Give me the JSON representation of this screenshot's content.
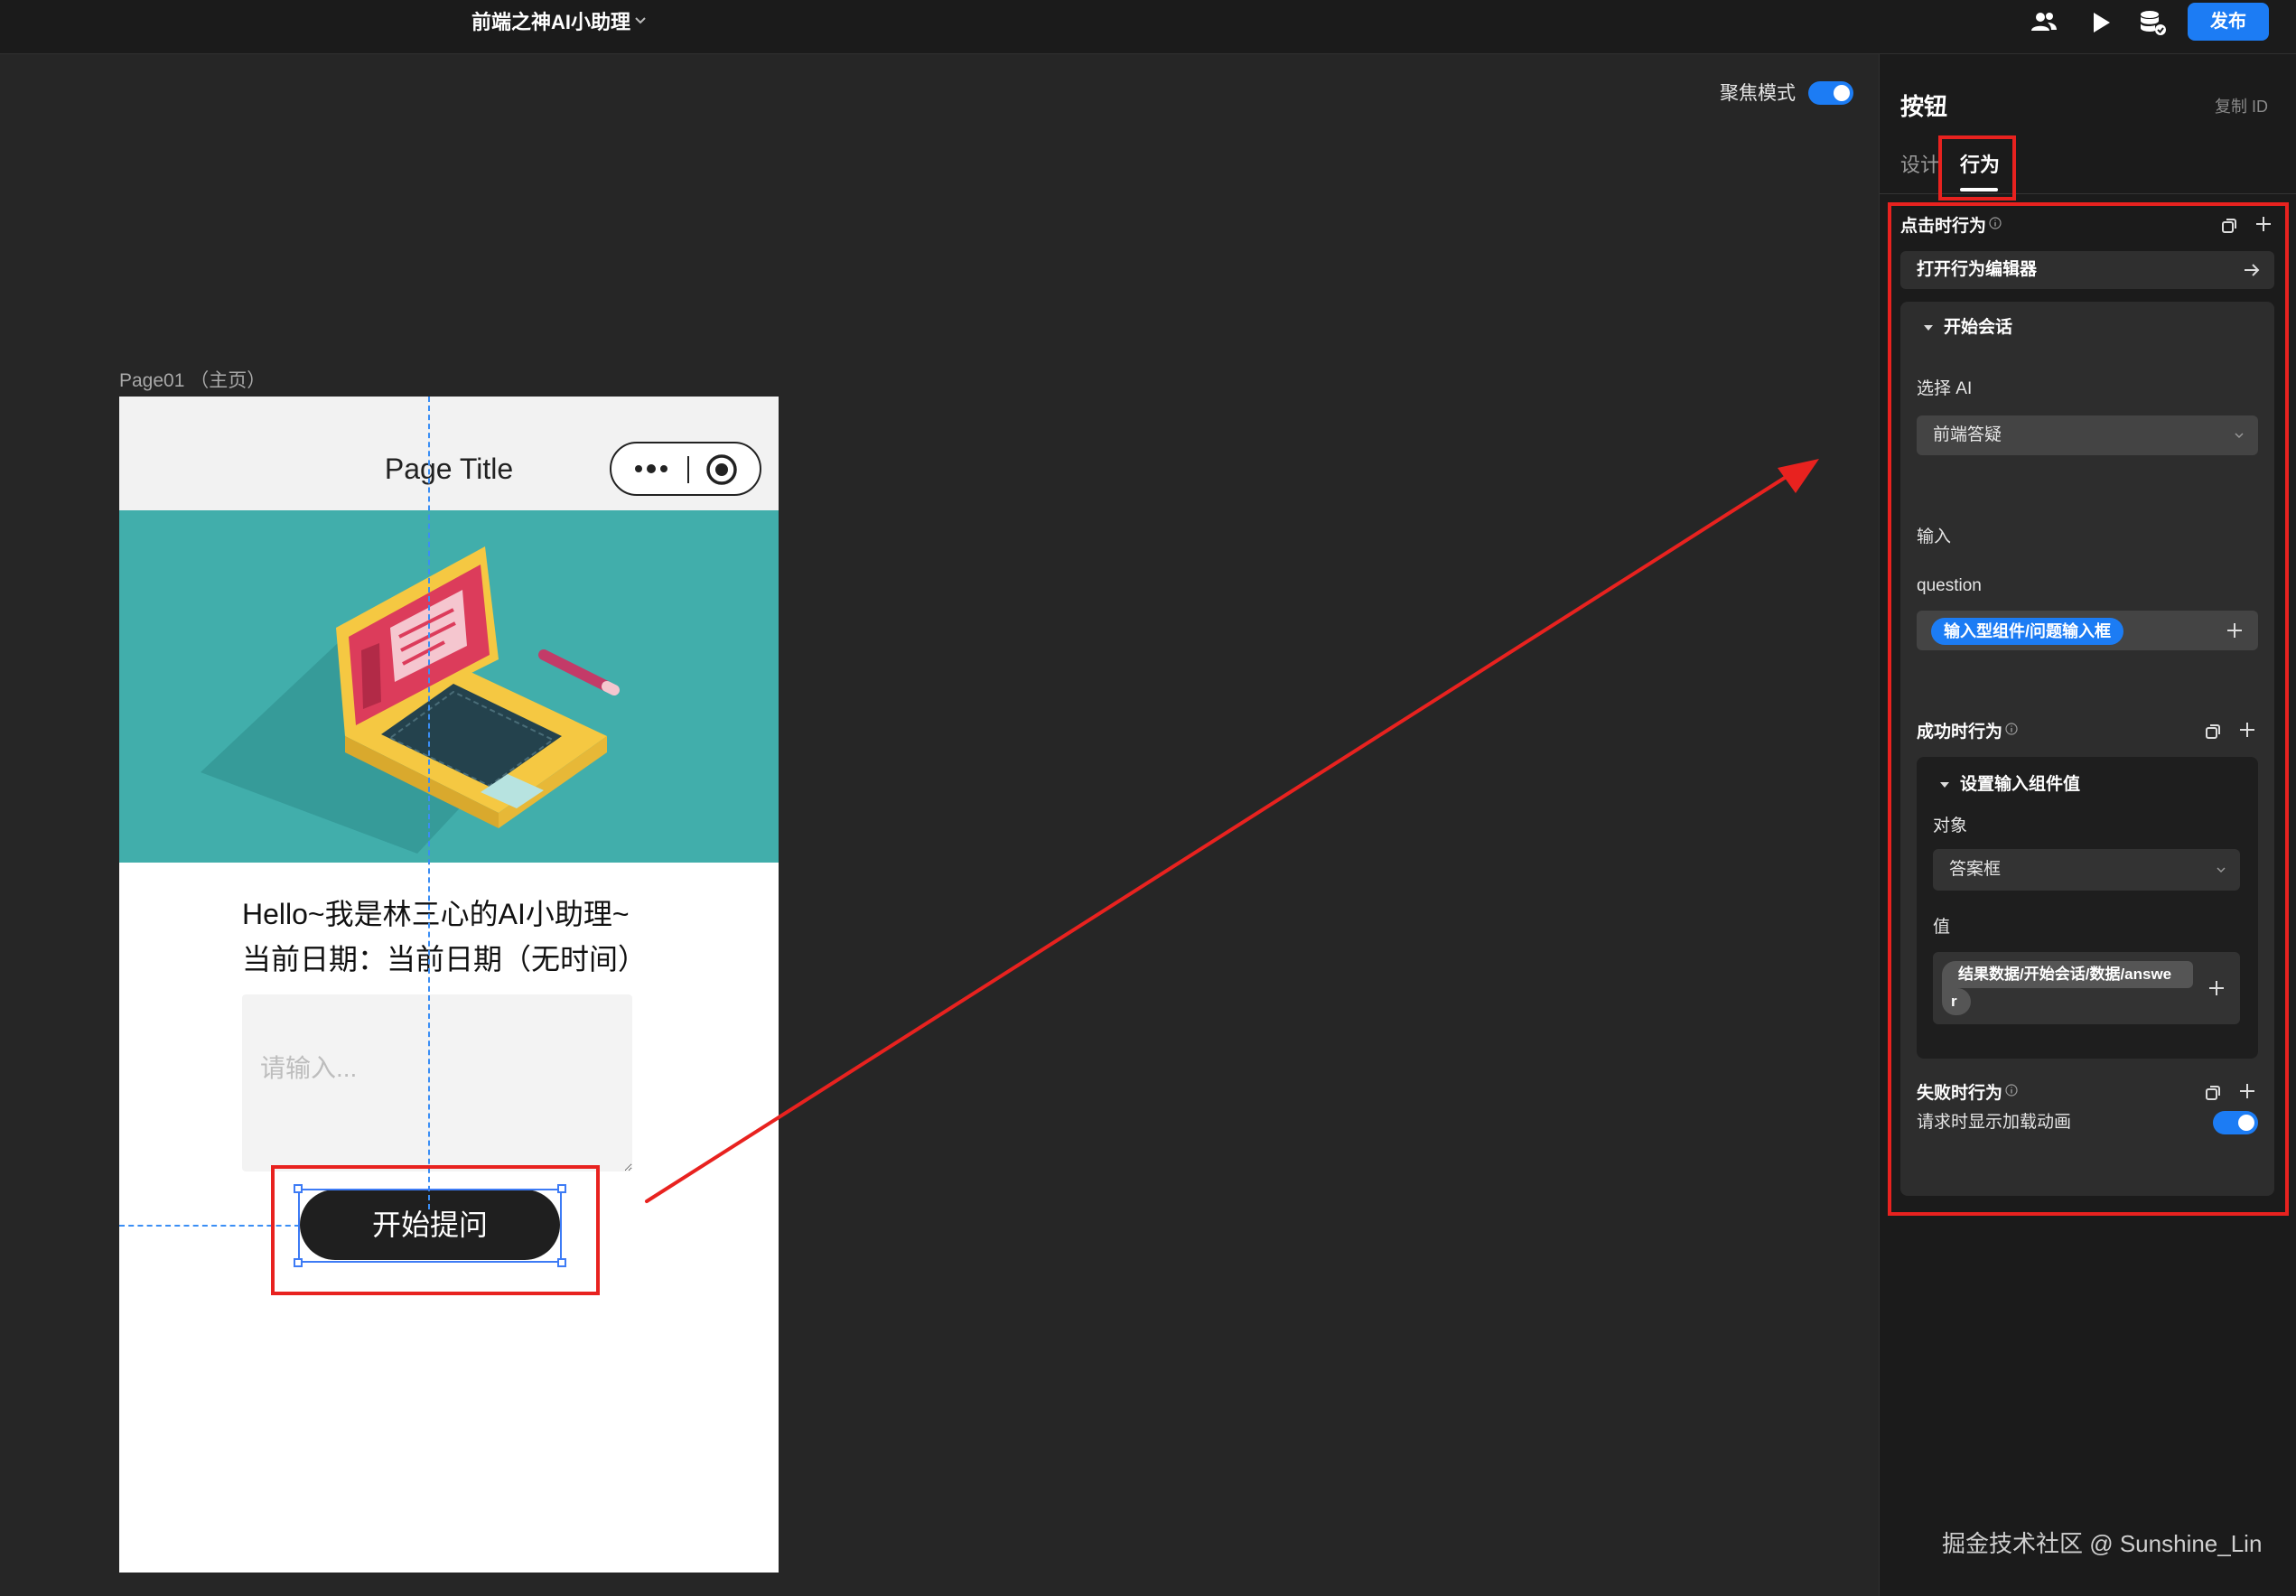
{
  "app": {
    "title": "前端之神AI小助理",
    "publish_label": "发布"
  },
  "focus_mode": {
    "label": "聚焦模式",
    "enabled": true
  },
  "canvas": {
    "page_label": "Page01 （主页）",
    "phone": {
      "title": "Page Title",
      "hello_text": "Hello~我是林三心的AI小助理~",
      "date_text": "当前日期：当前日期（无时间）",
      "input_placeholder": "请输入...",
      "button_label": "开始提问"
    }
  },
  "panel": {
    "title": "按钮",
    "copy_id": "复制 ID",
    "tabs": [
      {
        "label": "设计",
        "active": false
      },
      {
        "label": "行为",
        "active": true
      }
    ],
    "click_behavior": {
      "title": "点击时行为",
      "open_editor_label": "打开行为编辑器",
      "action": {
        "title": "开始会话",
        "select_ai_label": "选择 AI",
        "select_ai_value": "前端答疑",
        "input_label": "输入",
        "question_label": "question",
        "question_chip": "输入型组件/问题输入框"
      }
    },
    "success_behavior": {
      "title": "成功时行为",
      "action": {
        "title": "设置输入组件值",
        "target_label": "对象",
        "target_value": "答案框",
        "value_label": "值",
        "value_chip_line1": "结果数据/开始会话/数据/answe",
        "value_chip_line2": "r"
      }
    },
    "fail_behavior": {
      "title": "失败时行为",
      "loading_label": "请求时显示加载动画",
      "loading_enabled": true
    }
  },
  "watermark": "掘金技术社区 @ Sunshine_Lin",
  "colors": {
    "accent": "#1c7cf4",
    "annotation": "#e8221f",
    "banner": "#41aeab"
  }
}
